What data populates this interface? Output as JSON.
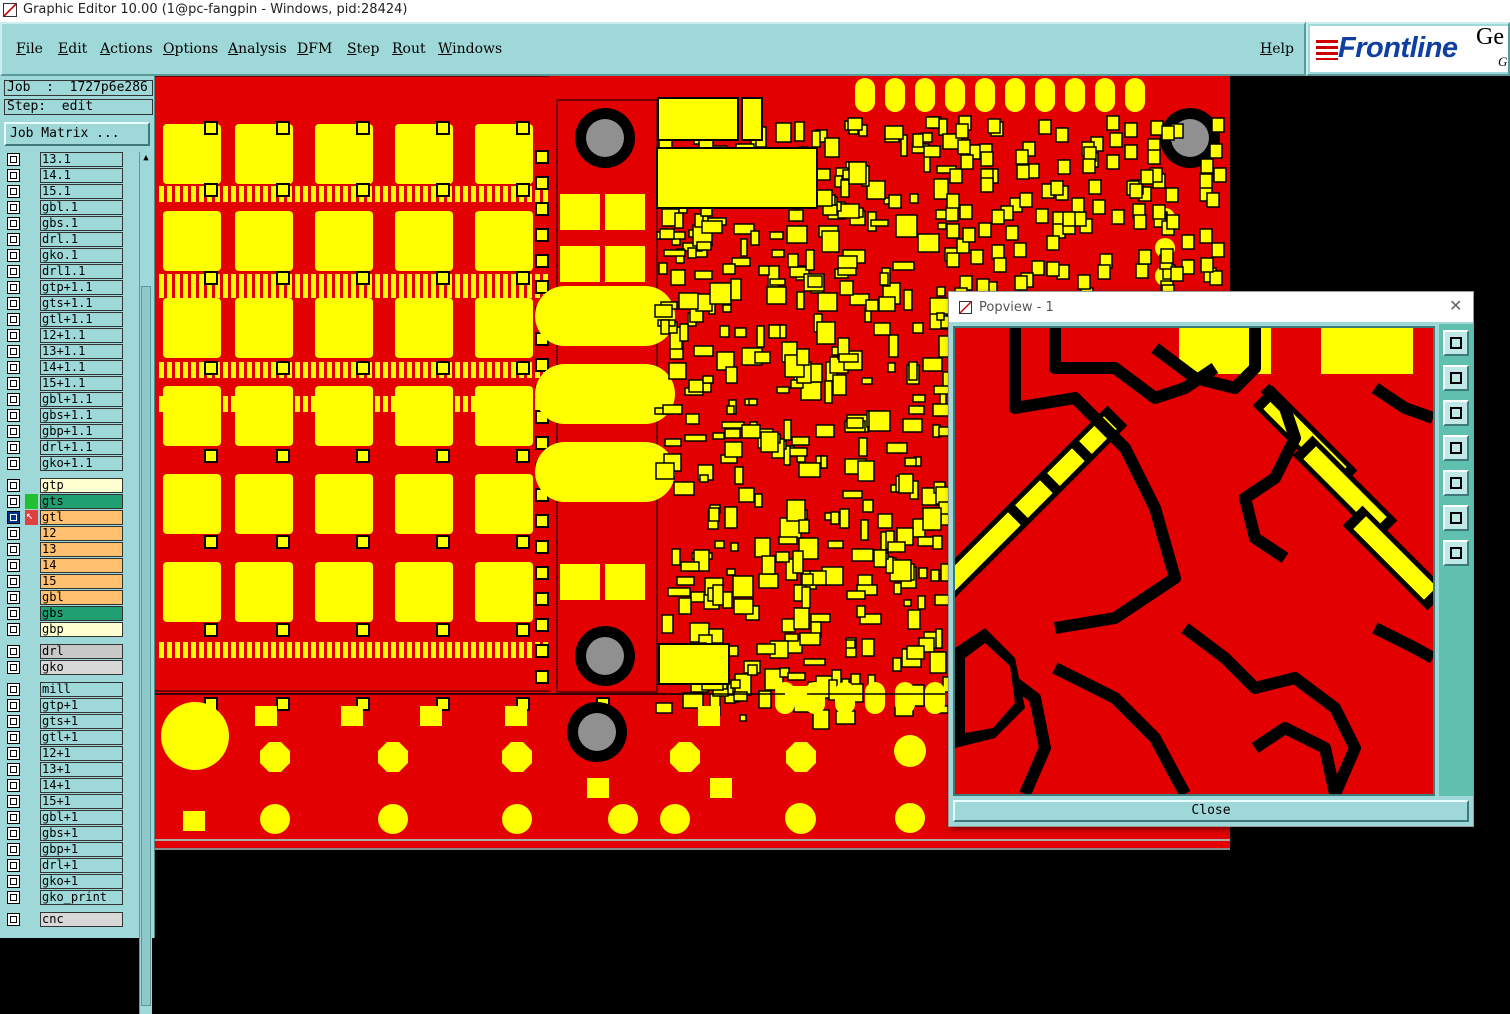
{
  "window": {
    "title": "Graphic Editor 10.00 (1@pc-fangpin - Windows, pid:28424)"
  },
  "menu": {
    "items": [
      "File",
      "Edit",
      "Actions",
      "Options",
      "Analysis",
      "DFM",
      "Step",
      "Rout",
      "Windows"
    ],
    "help": "Help"
  },
  "brand": {
    "logo": "Frontline",
    "partial_text": "Ge",
    "partial_sub": "G"
  },
  "panel": {
    "job_label": "Job  :  1727p6e286",
    "step_label": "Step:  edit",
    "job_matrix_button": "Job Matrix ..."
  },
  "layers": [
    {
      "name": "13.1",
      "color": "#9fd8d8"
    },
    {
      "name": "14.1",
      "color": "#9fd8d8"
    },
    {
      "name": "15.1",
      "color": "#9fd8d8"
    },
    {
      "name": "gbl.1",
      "color": "#9fd8d8"
    },
    {
      "name": "gbs.1",
      "color": "#9fd8d8"
    },
    {
      "name": "drl.1",
      "color": "#9fd8d8"
    },
    {
      "name": "gko.1",
      "color": "#9fd8d8"
    },
    {
      "name": "drl1.1",
      "color": "#9fd8d8"
    },
    {
      "name": "gtp+1.1",
      "color": "#9fd8d8"
    },
    {
      "name": "gts+1.1",
      "color": "#9fd8d8"
    },
    {
      "name": "gtl+1.1",
      "color": "#9fd8d8"
    },
    {
      "name": "12+1.1",
      "color": "#9fd8d8"
    },
    {
      "name": "13+1.1",
      "color": "#9fd8d8"
    },
    {
      "name": "14+1.1",
      "color": "#9fd8d8"
    },
    {
      "name": "15+1.1",
      "color": "#9fd8d8"
    },
    {
      "name": "gbl+1.1",
      "color": "#9fd8d8"
    },
    {
      "name": "gbs+1.1",
      "color": "#9fd8d8"
    },
    {
      "name": "gbp+1.1",
      "color": "#9fd8d8"
    },
    {
      "name": "drl+1.1",
      "color": "#9fd8d8"
    },
    {
      "name": "gko+1.1",
      "color": "#9fd8d8"
    },
    {
      "name": "gtp",
      "color": "#ffffd0",
      "group_start": true
    },
    {
      "name": "gts",
      "color": "#20a070"
    },
    {
      "name": "gtl",
      "color": "#ffc070",
      "active": true
    },
    {
      "name": "12",
      "color": "#ffc070"
    },
    {
      "name": "13",
      "color": "#ffc070"
    },
    {
      "name": "14",
      "color": "#ffc070"
    },
    {
      "name": "15",
      "color": "#ffc070"
    },
    {
      "name": "gbl",
      "color": "#ffc070"
    },
    {
      "name": "gbs",
      "color": "#20a070"
    },
    {
      "name": "gbp",
      "color": "#ffffd0"
    },
    {
      "name": "drl",
      "color": "#c8c8c8",
      "group_start": true
    },
    {
      "name": "gko",
      "color": "#d8d8d8"
    },
    {
      "name": "mill",
      "color": "#9fd8d8",
      "group_start": true
    },
    {
      "name": "gtp+1",
      "color": "#9fd8d8"
    },
    {
      "name": "gts+1",
      "color": "#9fd8d8"
    },
    {
      "name": "gtl+1",
      "color": "#9fd8d8"
    },
    {
      "name": "12+1",
      "color": "#9fd8d8"
    },
    {
      "name": "13+1",
      "color": "#9fd8d8"
    },
    {
      "name": "14+1",
      "color": "#9fd8d8"
    },
    {
      "name": "15+1",
      "color": "#9fd8d8"
    },
    {
      "name": "gbl+1",
      "color": "#9fd8d8"
    },
    {
      "name": "gbs+1",
      "color": "#9fd8d8"
    },
    {
      "name": "gbp+1",
      "color": "#9fd8d8"
    },
    {
      "name": "drl+1",
      "color": "#9fd8d8"
    },
    {
      "name": "gko+1",
      "color": "#9fd8d8"
    },
    {
      "name": "gko_print",
      "color": "#9fd8d8"
    },
    {
      "name": "cnc",
      "color": "#d8d8d8",
      "group_start": true
    }
  ],
  "popview": {
    "title": "Popview - 1",
    "close_button": "Close",
    "tools": [
      "zoom-home-icon",
      "pan-up-icon",
      "pan-down-icon",
      "pan-left-icon",
      "pan-right-icon",
      "zoom-fit-icon",
      "zoom-center-icon"
    ]
  },
  "colors": {
    "board": "#e30000",
    "copper": "#ffff00",
    "panel": "#9fd8d8",
    "hole": "#909090"
  }
}
